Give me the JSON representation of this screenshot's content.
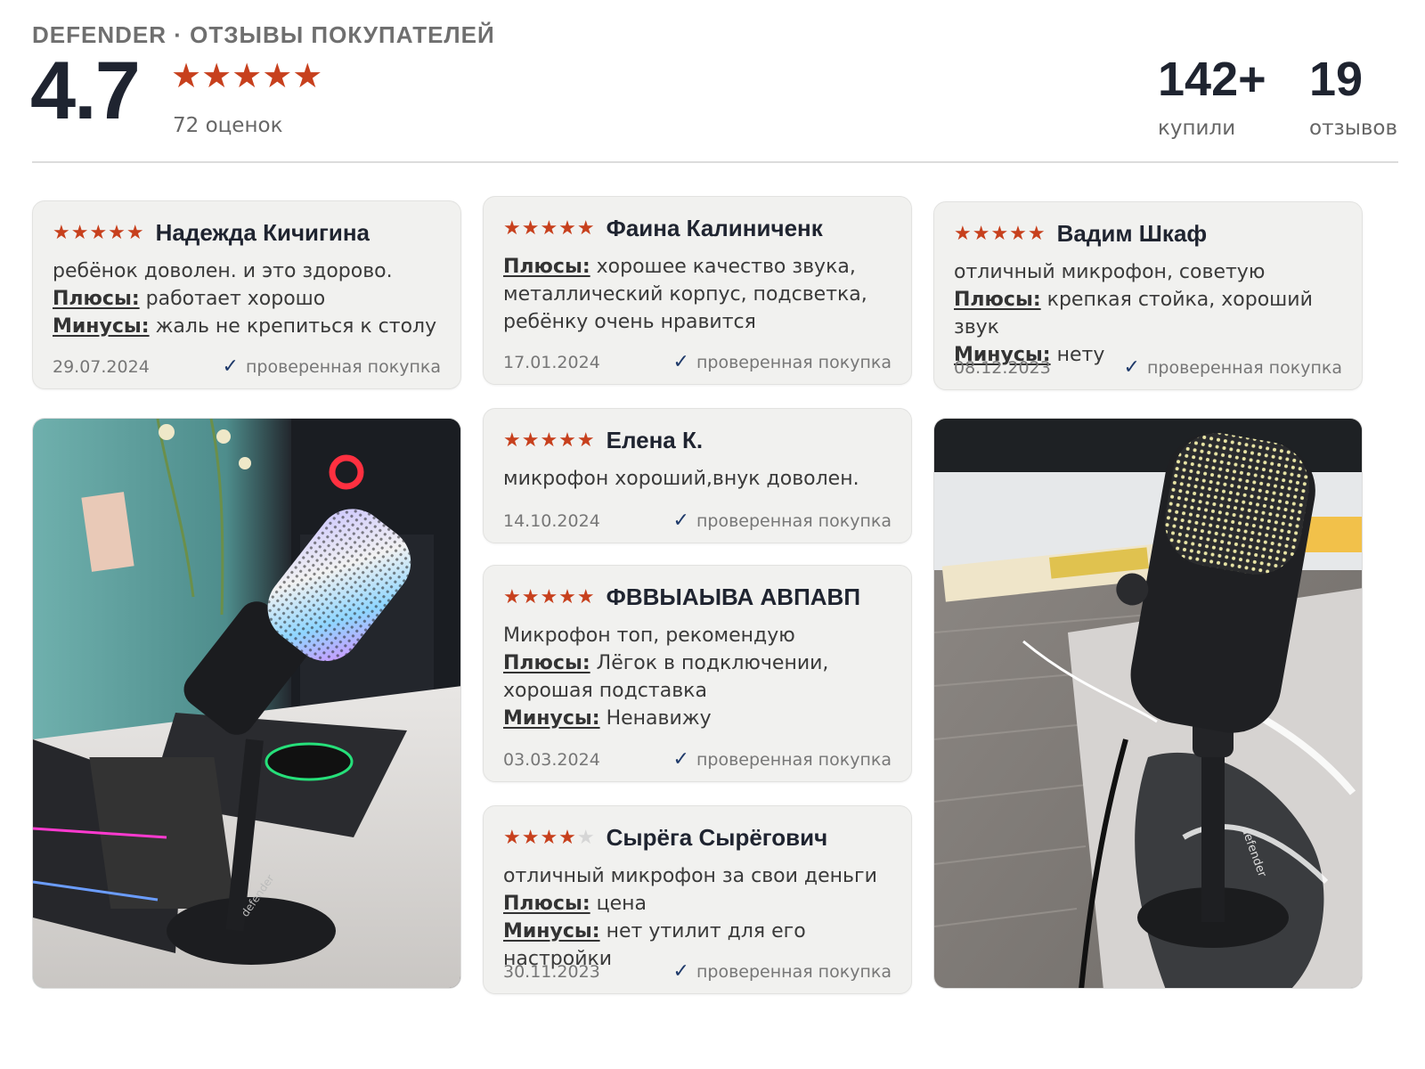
{
  "header": {
    "brand": "DEFENDER · ОТЗЫВЫ ПОКУПАТЕЛЕЙ",
    "rating": "4.7",
    "stars": "★★★★★",
    "rating_count": "72 оценок",
    "bought_num": "142+",
    "bought_label": "купили",
    "reviews_num": "19",
    "reviews_label": "отзывов"
  },
  "labels": {
    "plus": "Плюсы:",
    "minus": "Минусы:",
    "verified": "проверенная покупка",
    "check": "✓"
  },
  "reviews": [
    {
      "stars": "★★★★★",
      "author": "Надежда Кичигина",
      "text": "ребёнок доволен. и это здорово.",
      "plus": "работает хорошо",
      "minus": "жаль не крепиться к столу",
      "date": "29.07.2024"
    },
    {
      "stars": "★★★★★",
      "author": "Фаина Калиниченк",
      "plus": "хорошее качество звука, металлический корпус, подсветка, ребёнку очень нравится",
      "date": "17.01.2024"
    },
    {
      "stars": "★★★★★",
      "author": "Вадим Шкаф",
      "text": "отличный микрофон, советую",
      "plus": "крепкая стойка, хороший звук",
      "minus": "нету",
      "date": "08.12.2023"
    },
    {
      "stars": "★★★★★",
      "author": "Елена К.",
      "text": "микрофон хороший,внук доволен.",
      "date": "14.10.2024"
    },
    {
      "stars": "★★★★★",
      "author": "ФВВЫАЫВА АВПАВП",
      "text": "Микрофон топ, рекомендую",
      "plus": "Лёгок в подключении, хорошая подставка",
      "minus": "Ненавижу",
      "date": "03.03.2024"
    },
    {
      "stars_filled": "★★★★",
      "stars_empty": "★",
      "rating": 4,
      "author": "Сырёга Сырёгович",
      "text": "отличный микрофон за свои деньги",
      "plus": "цена",
      "minus": "нет утилит для его настройки",
      "date": "30.11.2023"
    }
  ],
  "photos": [
    {
      "caption": "",
      "brand_mark": "defender"
    },
    {
      "caption": "",
      "brand_mark": "defender"
    }
  ]
}
